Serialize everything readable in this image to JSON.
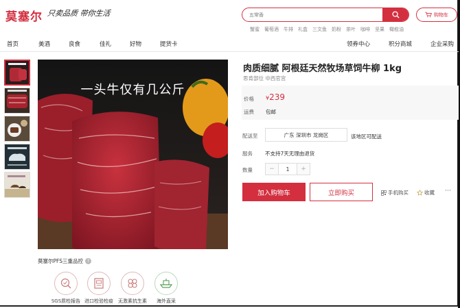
{
  "header": {
    "logo": "莫塞尔",
    "slogan": "只卖品质 带你生活",
    "search_placeholder": "五常香",
    "cart_label": "购物车",
    "hot_words": [
      "蟹蜜",
      "葡萄酒",
      "牛排",
      "礼盒",
      "三文鱼",
      "奶粉",
      "茶叶",
      "咖啡",
      "坚果",
      "橄榄油"
    ]
  },
  "nav": {
    "items": [
      "首页",
      "美酒",
      "良食",
      "佳礼",
      "好物",
      "提货卡"
    ],
    "right_items": [
      "领券中心",
      "积分商城",
      "企业采购"
    ]
  },
  "gallery": {
    "caption": "一头牛仅有几公斤"
  },
  "product": {
    "title": "肉质细腻 阿根廷天然牧场草饲牛柳 1kg",
    "brand": "思肯部位 中西官宫",
    "price_label": "价格",
    "price_symbol": "¥",
    "price_value": "239",
    "shipping_label": "运费",
    "shipping_value": "包邮",
    "delivery_label": "配送至",
    "delivery_address": "广东 深圳市 龙岗区",
    "delivery_status": "该地区可配送",
    "service_label": "服务",
    "service_value": "不支持7天无理由退货",
    "qty_label": "数量",
    "qty_value": "1",
    "qty_minus": "−",
    "qty_plus": "+",
    "add_cart": "加入购物车",
    "buy_now": "立即购买",
    "mobile_buy": "手机购买",
    "favorite": "收藏",
    "more": "⋯"
  },
  "quality": {
    "title": "莫塞尔PFS三重品控",
    "help": "?",
    "items": [
      "SGS质检报告",
      "进口检验检疫",
      "无激素抗生素",
      "海外直采"
    ]
  },
  "colors": {
    "accent": "#d32f3f"
  }
}
